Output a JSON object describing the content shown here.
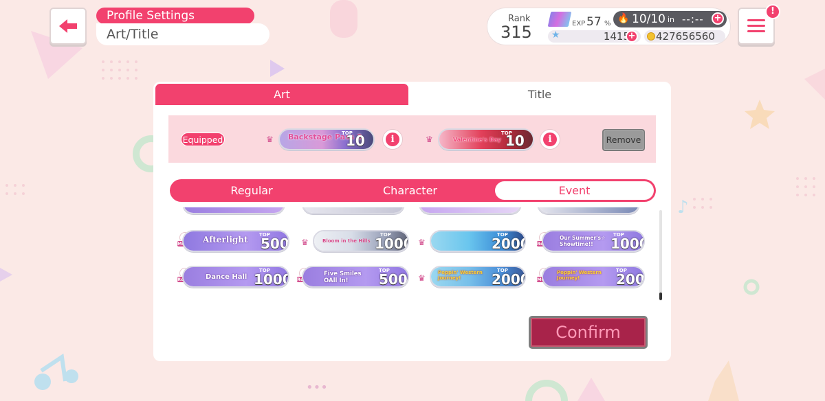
{
  "header": {
    "breadcrumb_parent": "Profile Settings",
    "breadcrumb_current": "Art/Title",
    "back_icon": "back-arrow-icon",
    "menu_icon": "hamburger-menu-icon",
    "notification_badge": "!"
  },
  "status": {
    "rank_label": "Rank",
    "rank_value": "315",
    "exp_label": "EXP",
    "exp_value": "57",
    "exp_unit": "%",
    "stamina_value": "10/10",
    "stamina_in": "in",
    "stamina_timer": "--:--",
    "stars": "1415",
    "coins": "427656560",
    "plus": "+"
  },
  "tabs": {
    "art": "Art",
    "title": "Title"
  },
  "equipped": {
    "label": "Equipped",
    "items": [
      {
        "text": "Backstage Pass 3",
        "top_label": "TOP",
        "rank": "10"
      },
      {
        "text": "Valentine's Day",
        "top_label": "TOP",
        "rank": "10"
      }
    ],
    "remove_label": "Remove",
    "info_glyph": "i"
  },
  "subtabs": {
    "regular": "Regular",
    "character": "Character",
    "event": "Event"
  },
  "titles": [
    {
      "badge": "Medley",
      "text": "Afterlight",
      "top_label": "TOP",
      "rank": "500",
      "crown": false
    },
    {
      "badge": "",
      "text": "Bloom in the Hills",
      "top_label": "TOP",
      "rank": "1000",
      "crown": true
    },
    {
      "badge": "",
      "text": "",
      "top_label": "TOP",
      "rank": "2000",
      "crown": true
    },
    {
      "badge": "Round1",
      "text": "Our Summer's☆ Showtime!!",
      "top_label": "TOP",
      "rank": "1000",
      "crown": false
    },
    {
      "badge": "Round1",
      "text": "Dance Hall",
      "top_label": "TOP",
      "rank": "1000",
      "crown": false
    },
    {
      "badge": "Round1",
      "text": "Five Smiles OAll In!",
      "top_label": "TOP",
      "rank": "500",
      "crown": false
    },
    {
      "badge": "",
      "text": "Poppin' Western Journey!",
      "top_label": "TOP",
      "rank": "2000",
      "crown": true
    },
    {
      "badge": "Medley",
      "text": "Poppin' Western Journey!",
      "top_label": "TOP",
      "rank": "200",
      "crown": false
    }
  ],
  "confirm_label": "Confirm",
  "colors": {
    "accent": "#f2416e",
    "background": "#fbe9e6",
    "confirm": "#a8234a"
  }
}
